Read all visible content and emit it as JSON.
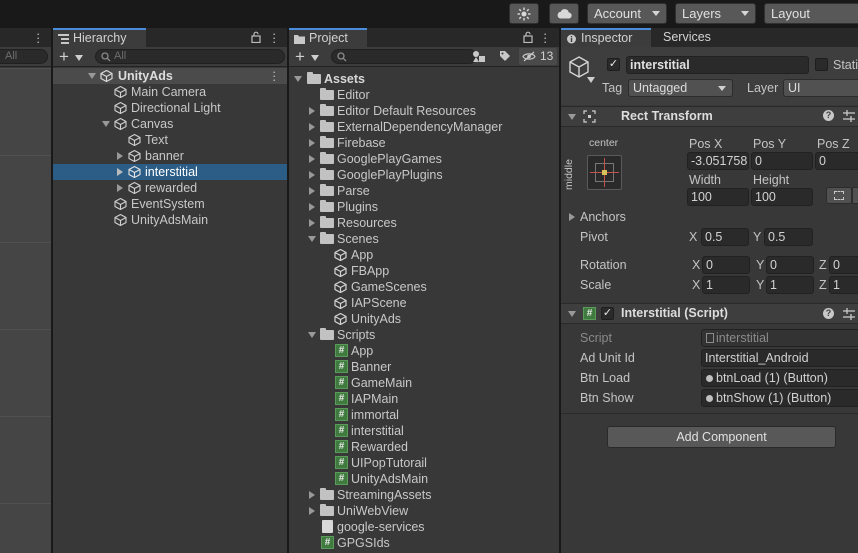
{
  "toolbar": {
    "account_label": "Account",
    "layers_label": "Layers",
    "layout_label": "Layout"
  },
  "left_panel": {
    "search_placeholder": "All"
  },
  "hierarchy": {
    "tab_label": "Hierarchy",
    "search_placeholder": "All",
    "scene": "UnityAds",
    "items": [
      {
        "label": "Main Camera"
      },
      {
        "label": "Directional Light"
      },
      {
        "label": "Canvas"
      },
      {
        "label": "Text"
      },
      {
        "label": "banner"
      },
      {
        "label": "interstitial"
      },
      {
        "label": "rewarded"
      },
      {
        "label": "EventSystem"
      },
      {
        "label": "UnityAdsMain"
      }
    ]
  },
  "project": {
    "tab_label": "Project",
    "visibility_count": "13",
    "root": "Assets",
    "items": [
      {
        "label": "Editor"
      },
      {
        "label": "Editor Default Resources"
      },
      {
        "label": "ExternalDependencyManager"
      },
      {
        "label": "Firebase"
      },
      {
        "label": "GooglePlayGames"
      },
      {
        "label": "GooglePlayPlugins"
      },
      {
        "label": "Parse"
      },
      {
        "label": "Plugins"
      },
      {
        "label": "Resources"
      },
      {
        "label": "Scenes"
      },
      {
        "label": "App"
      },
      {
        "label": "FBApp"
      },
      {
        "label": "GameScenes"
      },
      {
        "label": "IAPScene"
      },
      {
        "label": "UnityAds"
      },
      {
        "label": "Scripts"
      },
      {
        "label": "App"
      },
      {
        "label": "Banner"
      },
      {
        "label": "GameMain"
      },
      {
        "label": "IAPMain"
      },
      {
        "label": "immortal"
      },
      {
        "label": "interstitial"
      },
      {
        "label": "Rewarded"
      },
      {
        "label": "UIPopTutorail"
      },
      {
        "label": "UnityAdsMain"
      },
      {
        "label": "StreamingAssets"
      },
      {
        "label": "UniWebView"
      },
      {
        "label": "google-services"
      },
      {
        "label": "GPGSIds"
      }
    ]
  },
  "inspector": {
    "tab_label": "Inspector",
    "services_tab_label": "Services",
    "object_name": "interstitial",
    "static_label": "Stati",
    "tag_label": "Tag",
    "tag_value": "Untagged",
    "layer_label": "Layer",
    "layer_value": "UI",
    "rect_transform": {
      "title": "Rect Transform",
      "anchor_h": "center",
      "anchor_v": "middle",
      "pos_x_label": "Pos X",
      "pos_y_label": "Pos Y",
      "pos_z_label": "Pos Z",
      "pos_x": "-3.051758",
      "pos_y": "0",
      "pos_z": "0",
      "width_label": "Width",
      "height_label": "Height",
      "width": "100",
      "height": "100",
      "anchors_label": "Anchors",
      "pivot_label": "Pivot",
      "pivot_x_label": "X",
      "pivot_y_label": "Y",
      "pivot_x": "0.5",
      "pivot_y": "0.5",
      "rotation_label": "Rotation",
      "rot_x_label": "X",
      "rot_y_label": "Y",
      "rot_z_label": "Z",
      "rot_x": "0",
      "rot_y": "0",
      "rot_z": "0",
      "scale_label": "Scale",
      "scale_x_label": "X",
      "scale_y_label": "Y",
      "scale_z_label": "Z",
      "scale_x": "1",
      "scale_y": "1",
      "scale_z": "1"
    },
    "script_component": {
      "title": "Interstitial (Script)",
      "script_label": "Script",
      "script_value": "interstitial",
      "ad_unit_label": "Ad Unit Id",
      "ad_unit_value": "Interstitial_Android",
      "btn_load_label": "Btn Load",
      "btn_load_value": "btnLoad (1) (Button)",
      "btn_show_label": "Btn Show",
      "btn_show_value": "btnShow (1) (Button)"
    },
    "add_component_label": "Add Component"
  }
}
